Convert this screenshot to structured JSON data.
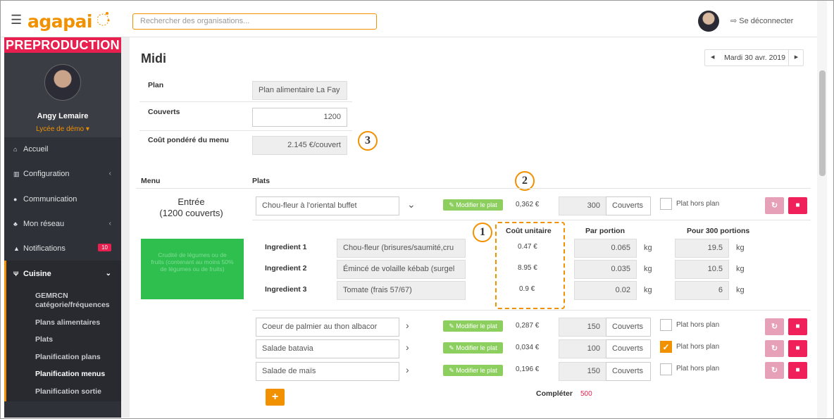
{
  "app": {
    "logo": "agapai",
    "search_placeholder": "Rechercher des organisations...",
    "logout_label": "Se déconnecter"
  },
  "sidebar": {
    "env_label": "PREPRODUCTION",
    "user_name": "Angy Lemaire",
    "school": "Lycée de démo ▾",
    "items": [
      {
        "label": "Accueil"
      },
      {
        "label": "Configuration"
      },
      {
        "label": "Communication"
      },
      {
        "label": "Mon réseau"
      },
      {
        "label": "Notifications",
        "badge": "10"
      },
      {
        "label": "Cuisine"
      }
    ],
    "cuisine_sub": [
      "GEMRCN",
      "catégorie/fréquences",
      "Plans alimentaires",
      "Plats",
      "Planification plans",
      "Planification menus",
      "Planification sortie"
    ]
  },
  "page": {
    "title": "Midi",
    "date": "Mardi 30 avr. 2019",
    "plan_label": "Plan",
    "plan_value": "Plan alimentaire La Fay",
    "couverts_label": "Couverts",
    "couverts_value": "1200",
    "cout_label": "Coût pondéré du menu",
    "cout_value": "2.145 €/couvert",
    "col_menu": "Menu",
    "col_plats": "Plats",
    "entree_title": "Entrée",
    "entree_sub": "(1200 couverts)",
    "green_note": "Crudité de légumes ou de fruits (contenant au moins 50% de légumes ou de fruits)",
    "complete_label": "Compléter",
    "complete_value": "500"
  },
  "callouts": [
    "1",
    "2",
    "3"
  ],
  "plat_rows": [
    {
      "name": "Chou-fleur à l'oriental buffet",
      "modifier": "Modifier le plat",
      "price": "0,362 €",
      "couverts": "300",
      "couverts_unit": "Couverts",
      "hors_plan": "Plat hors plan",
      "checked": false
    },
    {
      "name": "Coeur de palmier au thon albacor",
      "modifier": "Modifier le plat",
      "price": "0,287 €",
      "couverts": "150",
      "couverts_unit": "Couverts",
      "hors_plan": "Plat hors plan",
      "checked": false
    },
    {
      "name": "Salade batavia",
      "modifier": "Modifier le plat",
      "price": "0,034 €",
      "couverts": "100",
      "couverts_unit": "Couverts",
      "hors_plan": "Plat hors plan",
      "checked": true
    },
    {
      "name": "Salade de maïs",
      "modifier": "Modifier le plat",
      "price": "0,196 €",
      "couverts": "150",
      "couverts_unit": "Couverts",
      "hors_plan": "Plat hors plan",
      "checked": false
    }
  ],
  "ingredients": {
    "col_cout": "Coût unitaire",
    "col_portion": "Par portion",
    "col_total": "Pour 300 portions",
    "rows": [
      {
        "label": "Ingredient 1",
        "name": "Chou-fleur (brisures/saumité,cru",
        "cout": "0.47 €",
        "portion": "0.065",
        "total": "19.5",
        "unit": "kg"
      },
      {
        "label": "Ingredient 2",
        "name": "Émincé de volaille kébab (surgel",
        "cout": "8.95 €",
        "portion": "0.035",
        "total": "10.5",
        "unit": "kg"
      },
      {
        "label": "Ingredient 3",
        "name": "Tomate (frais  57/67)",
        "cout": "0.9 €",
        "portion": "0.02",
        "total": "6",
        "unit": "kg"
      }
    ]
  },
  "colors": {
    "accent": "#f29100",
    "danger": "#f0215a",
    "sidebar": "#2e3138",
    "green": "#2fbf4f"
  }
}
